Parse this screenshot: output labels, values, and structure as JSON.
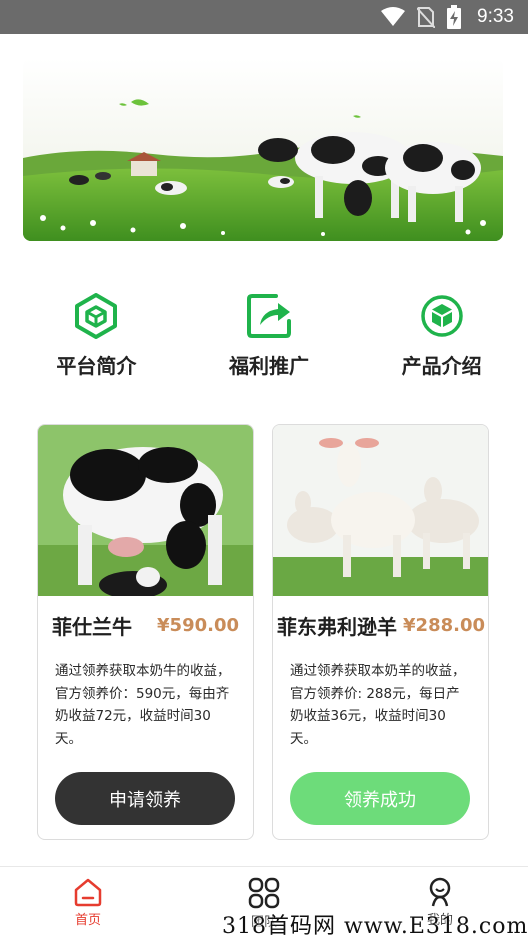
{
  "status_bar": {
    "time": "9:33"
  },
  "quick_nav": [
    {
      "label": "平台简介",
      "icon": "cube-icon"
    },
    {
      "label": "福利推广",
      "icon": "share-icon"
    },
    {
      "label": "产品介绍",
      "icon": "box-icon"
    }
  ],
  "products": [
    {
      "name": "菲仕兰牛",
      "price": "¥590.00",
      "description": "通过领养获取本奶牛的收益，官方领养价：590元，每由齐奶收益72元，收益时间30天。",
      "button": "申请领养"
    },
    {
      "name": "菲东弗利逊羊",
      "price": "¥288.00",
      "description": "通过领养获取本奶羊的收益，官方领养价: 288元，每日产奶收益36元，收益时间30天。",
      "button": "领养成功"
    }
  ],
  "tabs": [
    {
      "label": "首页",
      "icon": "home-icon",
      "active": true
    },
    {
      "label": "团队",
      "icon": "grid-icon",
      "active": false
    },
    {
      "label": "我的",
      "icon": "user-icon",
      "active": false
    }
  ],
  "watermark": "318首码网 www.E318.com",
  "colors": {
    "accent_green": "#1fb34b",
    "price": "#c98c59",
    "active_tab": "#e63c2f"
  }
}
